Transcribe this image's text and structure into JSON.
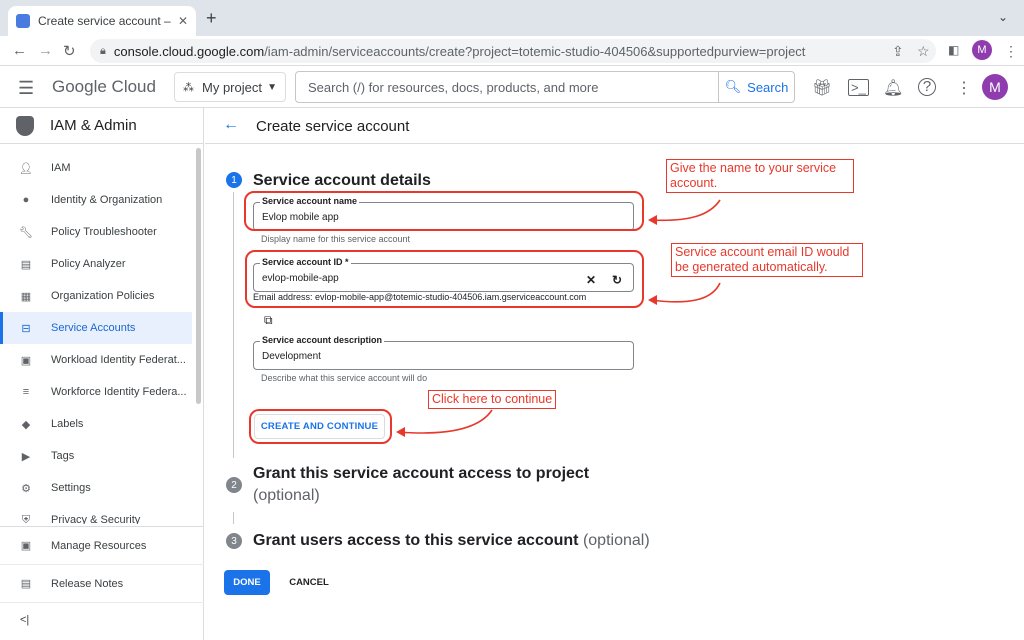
{
  "browser": {
    "tab_title": "Create service account – IAM",
    "tab_close": "✕",
    "new_tab": "+",
    "tab_menu": "⌄",
    "url_host": "console.cloud.google.com",
    "url_path": "/iam-admin/serviceaccounts/create?project=totemic-studio-404506&supportedpurview=project",
    "profile_initial": "M"
  },
  "header": {
    "logo": "Google Cloud",
    "project": "My project",
    "search_placeholder": "Search (/) for resources, docs, products, and more",
    "search_button": "Search",
    "avatar_initial": "M"
  },
  "sidebar": {
    "title": "IAM & Admin",
    "items": [
      {
        "label": "IAM",
        "icon": "person-add-icon"
      },
      {
        "label": "Identity & Organization",
        "icon": "account-circle-icon"
      },
      {
        "label": "Policy Troubleshooter",
        "icon": "wrench-icon"
      },
      {
        "label": "Policy Analyzer",
        "icon": "document-search-icon"
      },
      {
        "label": "Organization Policies",
        "icon": "policy-list-icon"
      },
      {
        "label": "Service Accounts",
        "icon": "service-account-icon",
        "active": true
      },
      {
        "label": "Workload Identity Federat...",
        "icon": "workload-identity-icon"
      },
      {
        "label": "Workforce Identity Federa...",
        "icon": "workforce-identity-icon"
      },
      {
        "label": "Labels",
        "icon": "label-icon"
      },
      {
        "label": "Tags",
        "icon": "tag-icon"
      },
      {
        "label": "Settings",
        "icon": "settings-gear-icon"
      },
      {
        "label": "Privacy & Security",
        "icon": "privacy-icon"
      }
    ],
    "bottom": [
      {
        "label": "Manage Resources",
        "icon": "manage-resources-icon"
      },
      {
        "label": "Release Notes",
        "icon": "release-notes-icon"
      }
    ],
    "collapse": "<|"
  },
  "main": {
    "title": "Create service account",
    "step1": {
      "number": "1",
      "title": "Service account details",
      "name_label": "Service account name",
      "name_value": "Evlop mobile app",
      "name_hint": "Display name for this service account",
      "id_label": "Service account ID *",
      "id_value": "evlop-mobile-app",
      "email_text": "Email address: evlop-mobile-app@totemic-studio-404506.iam.gserviceaccount.com",
      "desc_label": "Service account description",
      "desc_value": "Development",
      "desc_hint": "Describe what this service account will do",
      "create_button": "CREATE AND CONTINUE"
    },
    "step2": {
      "number": "2",
      "title": "Grant this service account access to project",
      "optional": "(optional)"
    },
    "step3": {
      "number": "3",
      "title": "Grant users access to this service account",
      "optional": "(optional)"
    },
    "done_button": "DONE",
    "cancel_button": "CANCEL"
  },
  "annotations": {
    "note1": "Give the name to your service account.",
    "note2": "Service account email ID would be generated automatically.",
    "note3": "Click here to continue",
    "color": "#e8382c"
  }
}
